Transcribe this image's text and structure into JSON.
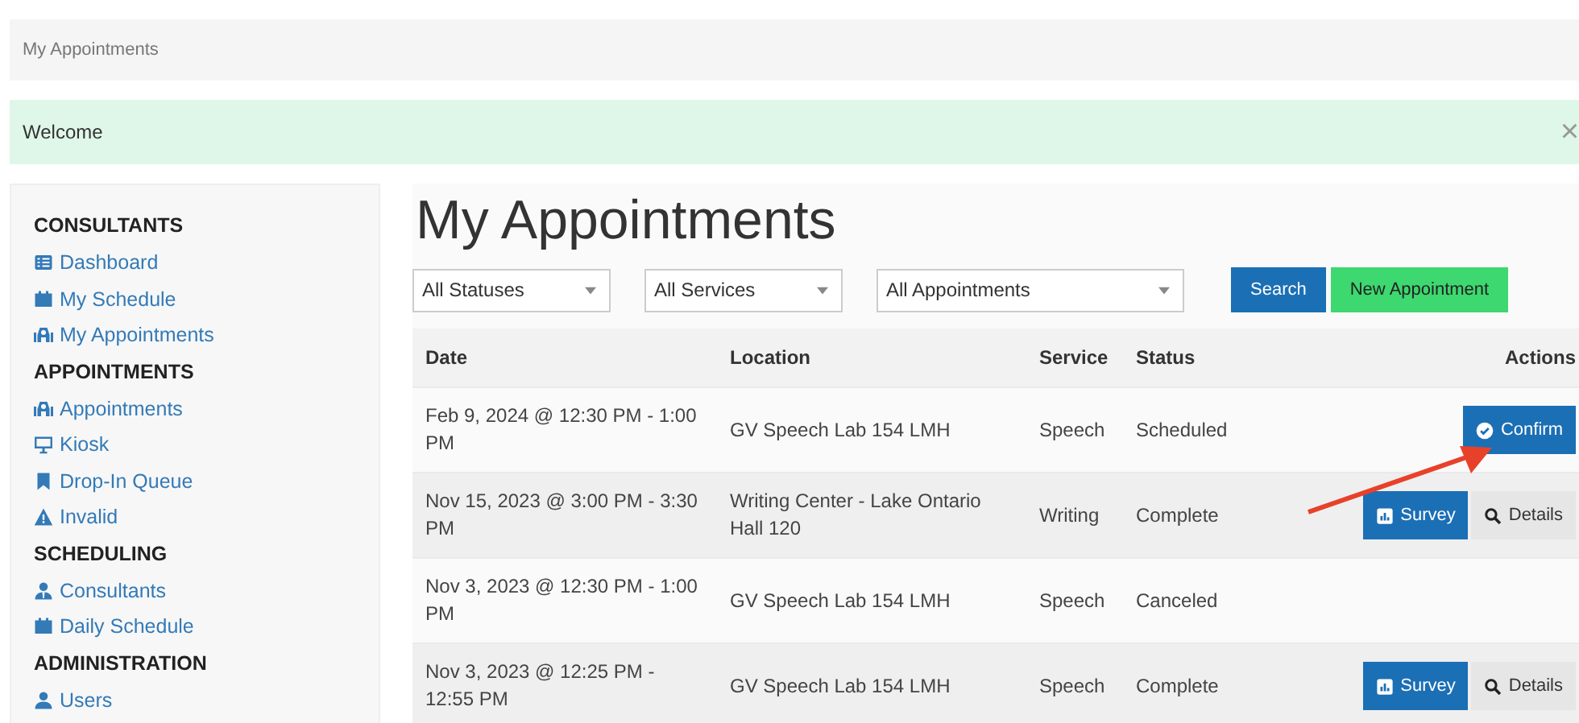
{
  "breadcrumb": "My Appointments",
  "alert": {
    "text": "Welcome",
    "close": "×"
  },
  "sidebar": [
    {
      "heading": "CONSULTANTS",
      "items": [
        {
          "label": "Dashboard",
          "kind": "list"
        },
        {
          "label": "My Schedule",
          "kind": "calendar"
        },
        {
          "label": "My Appointments",
          "kind": "people"
        }
      ]
    },
    {
      "heading": "APPOINTMENTS",
      "items": [
        {
          "label": "Appointments",
          "kind": "people"
        },
        {
          "label": "Kiosk",
          "kind": "monitor"
        },
        {
          "label": "Drop-In Queue",
          "kind": "bookmark"
        },
        {
          "label": "Invalid",
          "kind": "warning"
        }
      ]
    },
    {
      "heading": "SCHEDULING",
      "items": [
        {
          "label": "Consultants",
          "kind": "consultant"
        },
        {
          "label": "Daily Schedule",
          "kind": "calendar"
        }
      ]
    },
    {
      "heading": "ADMINISTRATION",
      "items": [
        {
          "label": "Users",
          "kind": "user"
        }
      ]
    }
  ],
  "title": "My Appointments",
  "filters": [
    {
      "value": "All Statuses"
    },
    {
      "value": "All Services"
    },
    {
      "value": "All Appointments"
    }
  ],
  "buttons": [
    {
      "label": "Search",
      "kind": "primary"
    },
    {
      "label": "New Appointment",
      "kind": "success"
    }
  ],
  "table": {
    "columns": [
      "Date",
      "Location",
      "Service",
      "Status",
      "Actions"
    ],
    "rows": [
      {
        "date": "Feb 9, 2024 @ 12:30 PM - 1:00 PM",
        "location": "GV Speech Lab 154 LMH",
        "service": "Speech",
        "status": "Scheduled",
        "actions": [
          {
            "kind": "confirm",
            "label": "Confirm"
          }
        ]
      },
      {
        "date": "Nov 15, 2023 @ 3:00 PM - 3:30 PM",
        "location": "Writing Center - Lake Ontario Hall 120",
        "service": "Writing",
        "status": "Complete",
        "actions": [
          {
            "kind": "survey",
            "label": "Survey"
          },
          {
            "kind": "details",
            "label": "Details"
          }
        ]
      },
      {
        "date": "Nov 3, 2023 @ 12:30 PM - 1:00 PM",
        "location": "GV Speech Lab 154 LMH",
        "service": "Speech",
        "status": "Canceled",
        "actions": []
      },
      {
        "date": "Nov 3, 2023 @ 12:25 PM - 12:55 PM",
        "location": "GV Speech Lab 154 LMH",
        "service": "Speech",
        "status": "Complete",
        "actions": [
          {
            "kind": "survey",
            "label": "Survey"
          },
          {
            "kind": "details",
            "label": "Details"
          }
        ]
      }
    ]
  }
}
